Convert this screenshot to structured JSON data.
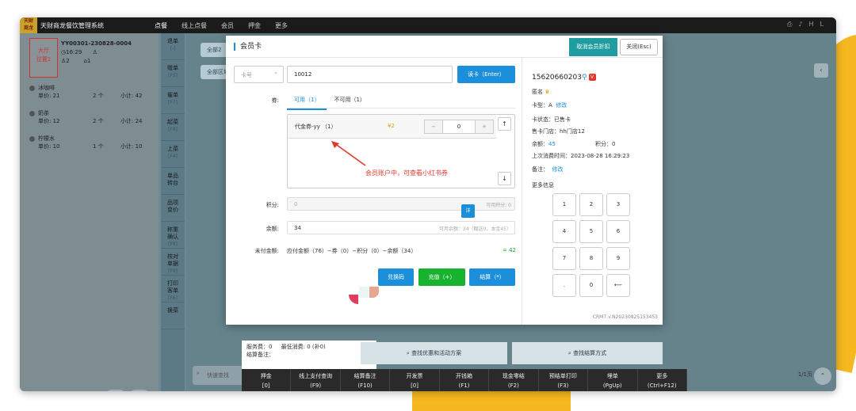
{
  "app": {
    "logo_text": "天财\n商龙",
    "title": "天财商龙餐饮管理系统",
    "nav": [
      "点餐",
      "线上点餐",
      "会员",
      "押金",
      "更多"
    ],
    "top_icons": [
      "printer-icon",
      "bell-icon",
      "user-icon"
    ],
    "top_user": "HL"
  },
  "order": {
    "table_area": "大厅",
    "table_pos": "位置1",
    "order_no": "YY00301-230828-0004",
    "time": "16:29",
    "guests": "2",
    "seats": "1",
    "items": [
      {
        "name": "冰咖啡",
        "price_label": "单价:",
        "price": "21",
        "qty": "2 个",
        "subtotal_label": "小计:",
        "subtotal": "42"
      },
      {
        "name": "奶茶",
        "price_label": "单价:",
        "price": "12",
        "qty": "2 个",
        "subtotal_label": "小计:",
        "subtotal": "24"
      },
      {
        "name": "柠檬水",
        "price_label": "单价:",
        "price": "10",
        "qty": "1 个",
        "subtotal_label": "小计:",
        "subtotal": "10"
      }
    ]
  },
  "side_buttons": [
    {
      "label": "退单",
      "key": "[-]"
    },
    {
      "label": "赠单",
      "key": "[F5]"
    },
    {
      "label": "催单",
      "key": "[F7]"
    },
    {
      "label": "起菜",
      "key": "[F8]"
    },
    {
      "label": "上菜",
      "key": "[F4]"
    },
    {
      "label": "单品\n转台",
      "key": ""
    },
    {
      "label": "品项\n变价",
      "key": ""
    },
    {
      "label": "称重\n确认",
      "key": "[F8]"
    },
    {
      "label": "核对\n单据",
      "key": "[F9]"
    },
    {
      "label": "打印\n客单",
      "key": "[F6]"
    },
    {
      "label": "换菜",
      "key": ""
    }
  ],
  "main": {
    "zone_tab_all": "全部2",
    "zone_area": "全部区域",
    "search_placeholder": "快速查找",
    "pager": "1/1页",
    "behind_service": "服务费：0",
    "behind_min": "最低消费: 0 (补0)",
    "behind_note": "结算备注：",
    "find_promo": "查找优惠和活动方案",
    "find_payment": "查找结算方式"
  },
  "bottom_bar": [
    {
      "label": "押金",
      "key": "[0]"
    },
    {
      "label": "线上支付查询",
      "key": "(F9)"
    },
    {
      "label": "结算备注",
      "key": "(F10)"
    },
    {
      "label": "开发票",
      "key": "[0]"
    },
    {
      "label": "开钱箱",
      "key": "(F1)"
    },
    {
      "label": "现金零结",
      "key": "(F2)"
    },
    {
      "label": "预结单打印",
      "key": "(F3)"
    },
    {
      "label": "埋单",
      "key": "(PgUp)"
    },
    {
      "label": "更多",
      "key": "(Ctrl+F12)"
    }
  ],
  "modal": {
    "title": "会员卡",
    "cancel_discount": "取消会员折扣",
    "close": "关闭(Esc)",
    "card_type_select": "卡号",
    "card_no": "10012",
    "read_card": "读卡（Enter）",
    "coupon_label": "券:",
    "tab_available": "可用（1）",
    "tab_unavailable": "不可用（1）",
    "coupon_name": "代金券-yy （1）",
    "coupon_value": "¥2",
    "coupon_qty": "0",
    "minus": "−",
    "plus": "+",
    "annotation": "会员账户中，可查看小红书券",
    "points_label": "积分:",
    "points_value": "0",
    "points_hint": "可用积分: 0",
    "eye_btn": "详",
    "balance_label": "余额:",
    "balance_value": "34",
    "balance_hint": "可用余额：34（赠送0，本金45）",
    "unpaid_label": "未付金额:",
    "unpaid_formula": "应付金额（76）−券（0）−积分（0）−余额（34）",
    "unpaid_value": "= 42",
    "btn_redeem": "兑换码",
    "btn_recharge": "充值（+）",
    "btn_settle": "结算（*）",
    "accent": "#1b8fd9",
    "green": "#17b32e"
  },
  "member": {
    "phone": "15620660203",
    "name_label": "匿名",
    "card_type": "卡型：A",
    "edit": "修改",
    "status": "卡状态：已售卡",
    "store": "售卡门店：hh门店12",
    "balance_label": "余额：",
    "balance": "45",
    "points": "积分：0",
    "last_time": "上次消费时间：2023-08-28 16:29:23",
    "remark_label": "备注：",
    "remark_edit": "修改",
    "more_info": "更多信息",
    "keys": [
      "1",
      "2",
      "3",
      "4",
      "5",
      "6",
      "7",
      "8",
      "9",
      ".",
      "0",
      "⟵"
    ],
    "version": "CRM7.v.N20230825153453"
  }
}
